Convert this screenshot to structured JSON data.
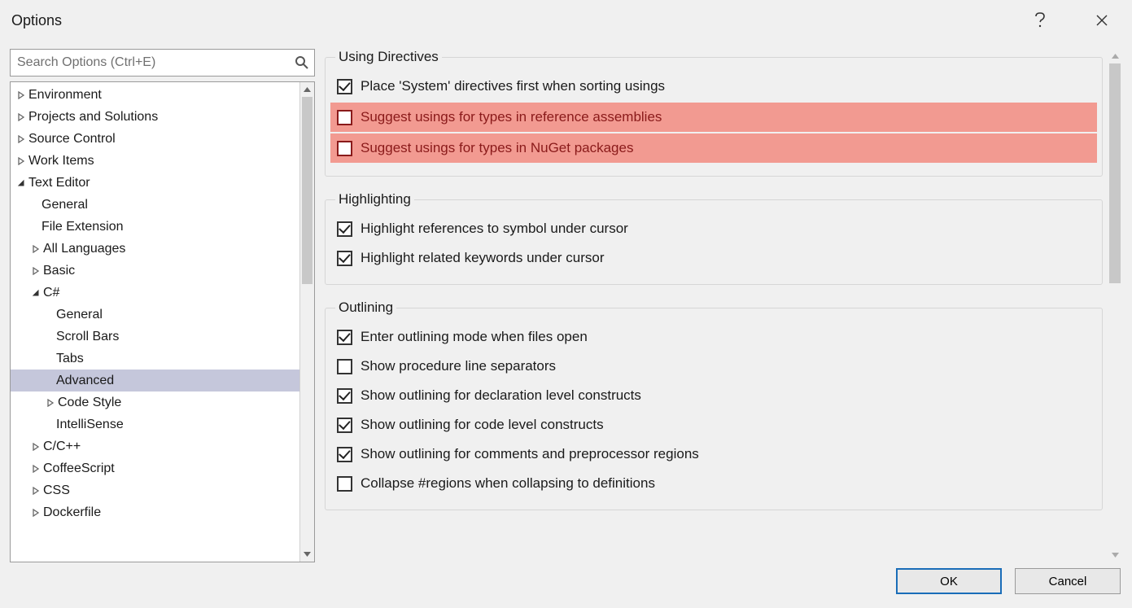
{
  "window": {
    "title": "Options"
  },
  "search": {
    "placeholder": "Search Options (Ctrl+E)"
  },
  "tree": [
    {
      "label": "Environment",
      "indent": 0,
      "expander": "collapsed"
    },
    {
      "label": "Projects and Solutions",
      "indent": 0,
      "expander": "collapsed"
    },
    {
      "label": "Source Control",
      "indent": 0,
      "expander": "collapsed"
    },
    {
      "label": "Work Items",
      "indent": 0,
      "expander": "collapsed"
    },
    {
      "label": "Text Editor",
      "indent": 0,
      "expander": "expanded"
    },
    {
      "label": "General",
      "indent": 1,
      "expander": "none"
    },
    {
      "label": "File Extension",
      "indent": 1,
      "expander": "none"
    },
    {
      "label": "All Languages",
      "indent": 1,
      "expander": "collapsed"
    },
    {
      "label": "Basic",
      "indent": 1,
      "expander": "collapsed"
    },
    {
      "label": "C#",
      "indent": 1,
      "expander": "expanded"
    },
    {
      "label": "General",
      "indent": 2,
      "expander": "none"
    },
    {
      "label": "Scroll Bars",
      "indent": 2,
      "expander": "none"
    },
    {
      "label": "Tabs",
      "indent": 2,
      "expander": "none"
    },
    {
      "label": "Advanced",
      "indent": 2,
      "expander": "none",
      "selected": true
    },
    {
      "label": "Code Style",
      "indent": 2,
      "expander": "collapsed"
    },
    {
      "label": "IntelliSense",
      "indent": 2,
      "expander": "none"
    },
    {
      "label": "C/C++",
      "indent": 1,
      "expander": "collapsed"
    },
    {
      "label": "CoffeeScript",
      "indent": 1,
      "expander": "collapsed"
    },
    {
      "label": "CSS",
      "indent": 1,
      "expander": "collapsed"
    },
    {
      "label": "Dockerfile",
      "indent": 1,
      "expander": "collapsed"
    }
  ],
  "groups": [
    {
      "legend": "Using Directives",
      "items": [
        {
          "label": "Place 'System' directives first when sorting usings",
          "checked": true,
          "highlighted": false
        },
        {
          "label": "Suggest usings for types in reference assemblies",
          "checked": false,
          "highlighted": true
        },
        {
          "label": "Suggest usings for types in NuGet packages",
          "checked": false,
          "highlighted": true
        }
      ]
    },
    {
      "legend": "Highlighting",
      "items": [
        {
          "label": "Highlight references to symbol under cursor",
          "checked": true,
          "highlighted": false
        },
        {
          "label": "Highlight related keywords under cursor",
          "checked": true,
          "highlighted": false
        }
      ]
    },
    {
      "legend": "Outlining",
      "items": [
        {
          "label": "Enter outlining mode when files open",
          "checked": true,
          "highlighted": false
        },
        {
          "label": "Show procedure line separators",
          "checked": false,
          "highlighted": false
        },
        {
          "label": "Show outlining for declaration level constructs",
          "checked": true,
          "highlighted": false
        },
        {
          "label": "Show outlining for code level constructs",
          "checked": true,
          "highlighted": false
        },
        {
          "label": "Show outlining for comments and preprocessor regions",
          "checked": true,
          "highlighted": false
        },
        {
          "label": "Collapse #regions when collapsing to definitions",
          "checked": false,
          "highlighted": false
        }
      ]
    }
  ],
  "footer": {
    "ok": "OK",
    "cancel": "Cancel"
  }
}
